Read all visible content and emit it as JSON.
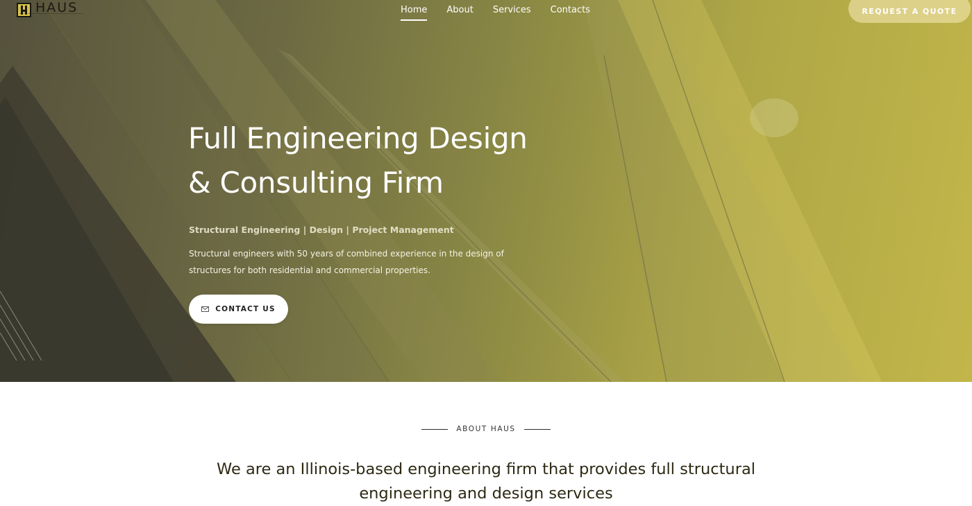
{
  "brand": {
    "name": "HAUS"
  },
  "nav": {
    "items": [
      {
        "label": "Home",
        "active": true
      },
      {
        "label": "About",
        "active": false
      },
      {
        "label": "Services",
        "active": false
      },
      {
        "label": "Contacts",
        "active": false
      }
    ],
    "quote_button": "REQUEST A QUOTE"
  },
  "hero": {
    "title_line1": "Full Engineering Design",
    "title_line2": "& Consulting Firm",
    "subtitle": "Structural Engineering | Design | Project Management",
    "description": "Structural engineers with 50 years of combined experience in the design of structures for both residential and commercial properties.",
    "cta_label": "CONTACT US",
    "cta_icon": "envelope-icon"
  },
  "about": {
    "label": "ABOUT HAUS",
    "heading": "We are an Illinois-based engineering firm that provides full structural engineering and design services"
  },
  "colors": {
    "accent_gold": "#d9c24a",
    "hero_dark": "#55523d",
    "hero_light": "#c2b64a",
    "about_text": "#2d2914"
  }
}
